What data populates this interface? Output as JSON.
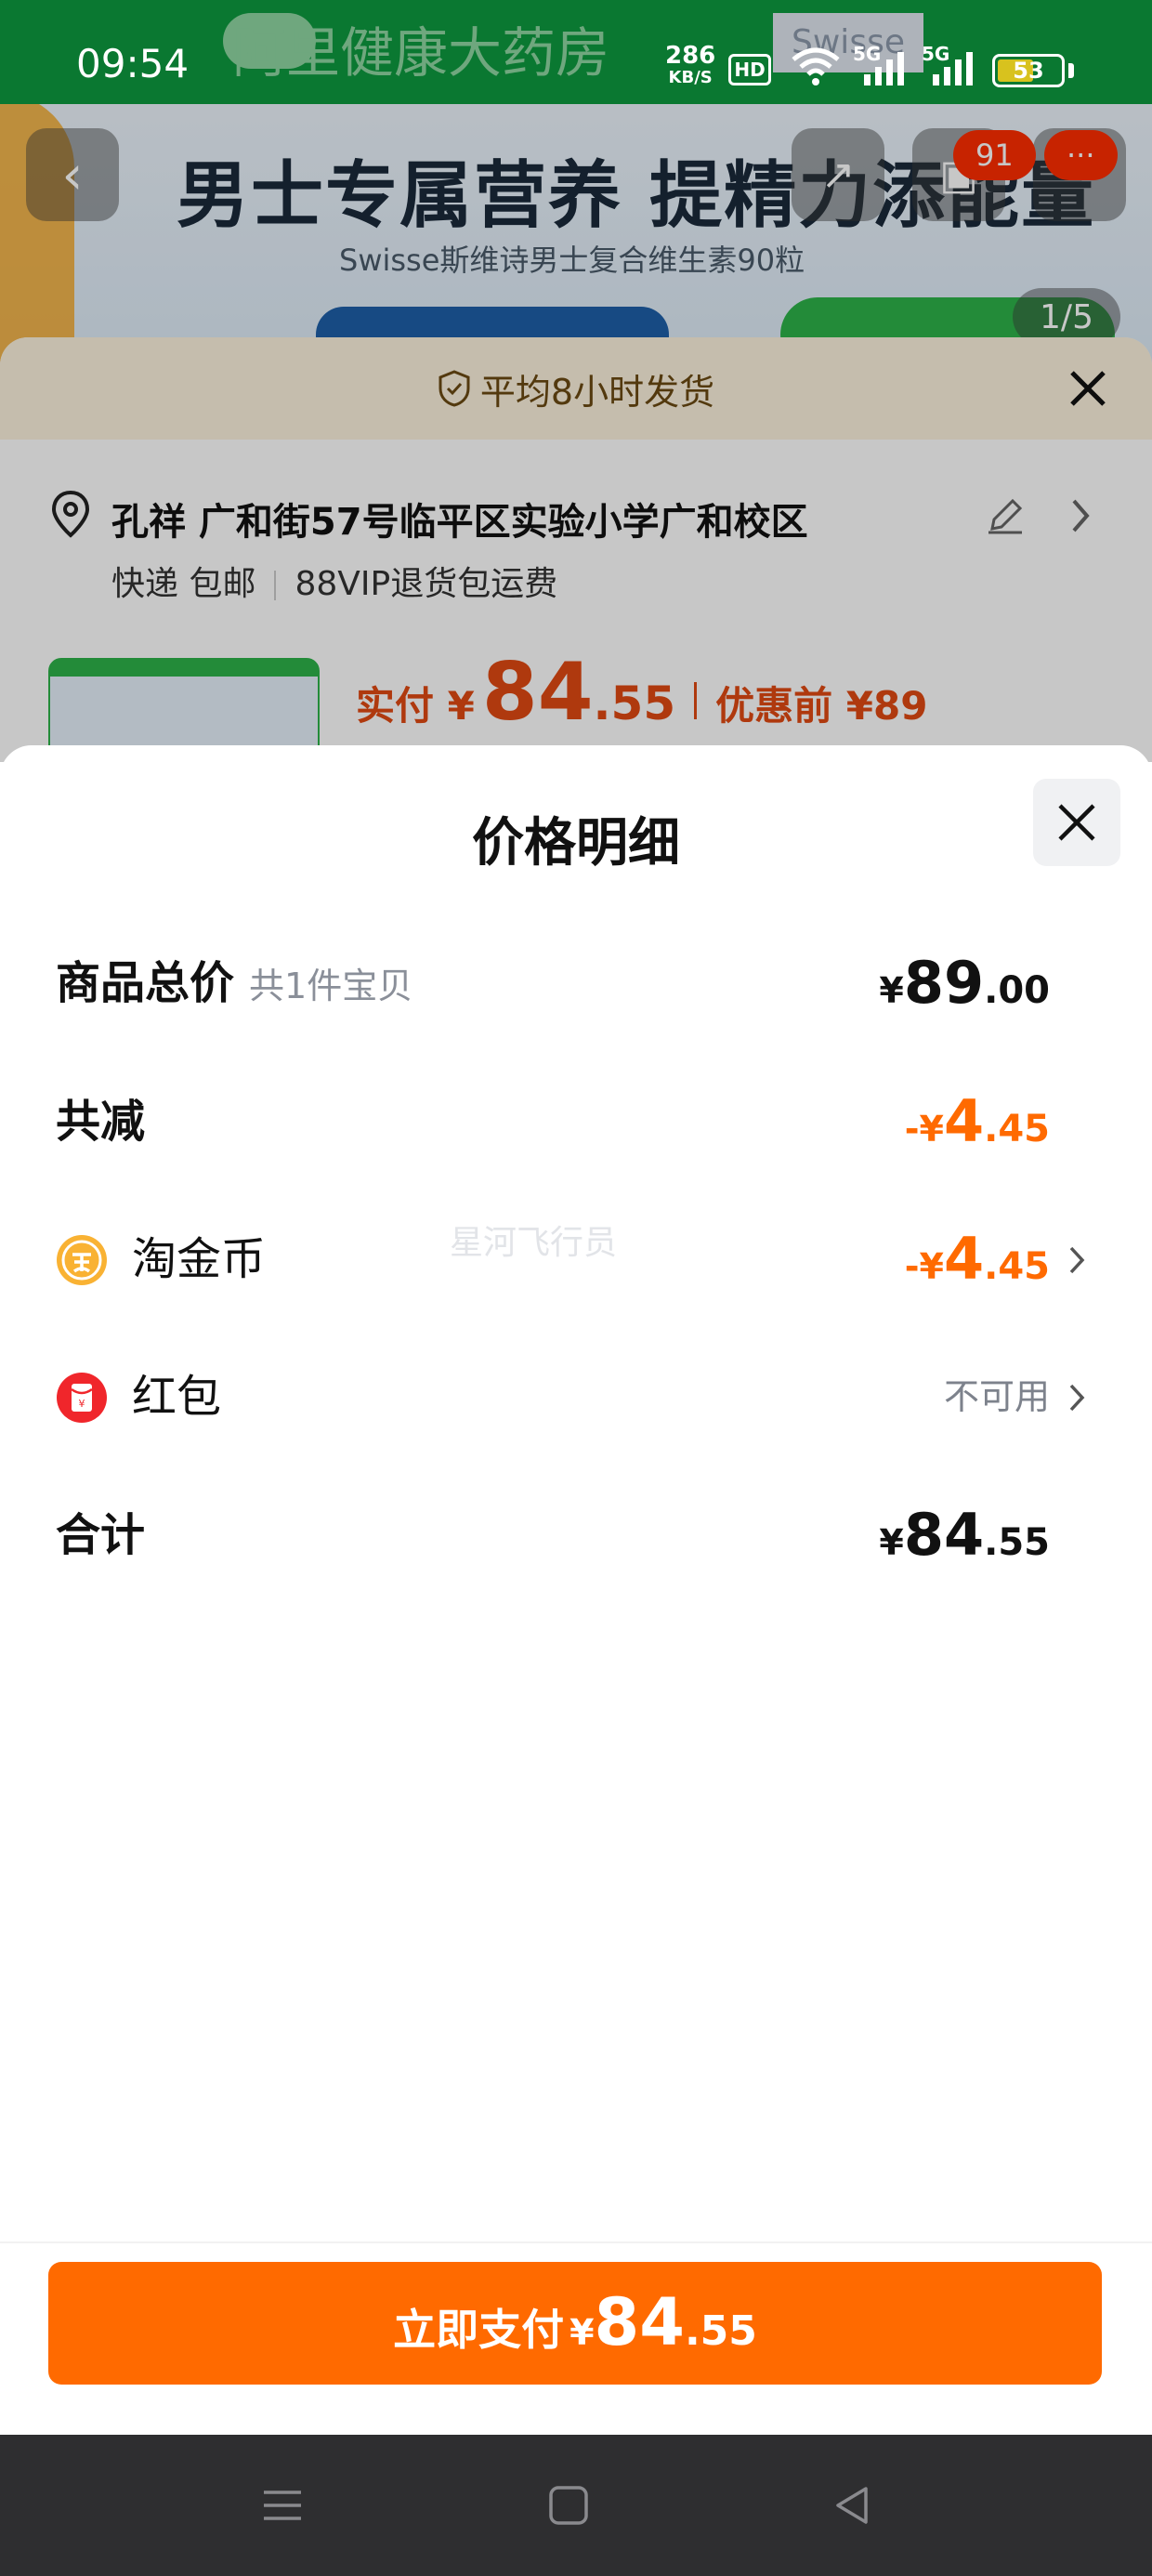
{
  "status_bar": {
    "time": "09:54",
    "net_speed_value": "286",
    "net_speed_unit": "KB/S",
    "hd_label": "HD",
    "sig1_label": "5G",
    "sig2_label": "5G",
    "battery": "53"
  },
  "background": {
    "store_logo_text": "阿里健康大药房",
    "brand_logo_text": "Swisse",
    "hero_headline": "男士专属营养 提精力添能量",
    "hero_subline": "Swisse斯维诗男士复合维生素90粒",
    "cart_badge": "91",
    "more_badge": "···",
    "image_counter": "1/5",
    "shipping_notice": "平均8小时发货",
    "address": "孔祥 广和街57号临平区实验小学广和校区",
    "delivery_method": "快递 包邮",
    "return_policy": "88VIP退货包运费",
    "paid_label": "实付 ¥",
    "paid_int": "84",
    "paid_dec": ".55",
    "before_discount": "优惠前 ¥89"
  },
  "sheet": {
    "title": "价格明细",
    "rows": {
      "total": {
        "label": "商品总价",
        "sub": "共1件宝贝",
        "cur": "¥",
        "int": "89",
        "dec": ".00"
      },
      "discount": {
        "label": "共减",
        "cur": "-¥",
        "int": "4",
        "dec": ".45"
      },
      "coins": {
        "label": "淘金币",
        "cur": "-¥",
        "int": "4",
        "dec": ".45"
      },
      "redpacket": {
        "label": "红包",
        "status": "不可用"
      },
      "sum": {
        "label": "合计",
        "cur": "¥",
        "int": "84",
        "dec": ".55"
      }
    },
    "watermark": "星河飞行员",
    "pay_button": {
      "label": "立即支付",
      "cur": "¥",
      "int": "84",
      "dec": ".55"
    }
  },
  "colors": {
    "accent": "#ff6a00",
    "status_green": "#0e9a3f"
  }
}
